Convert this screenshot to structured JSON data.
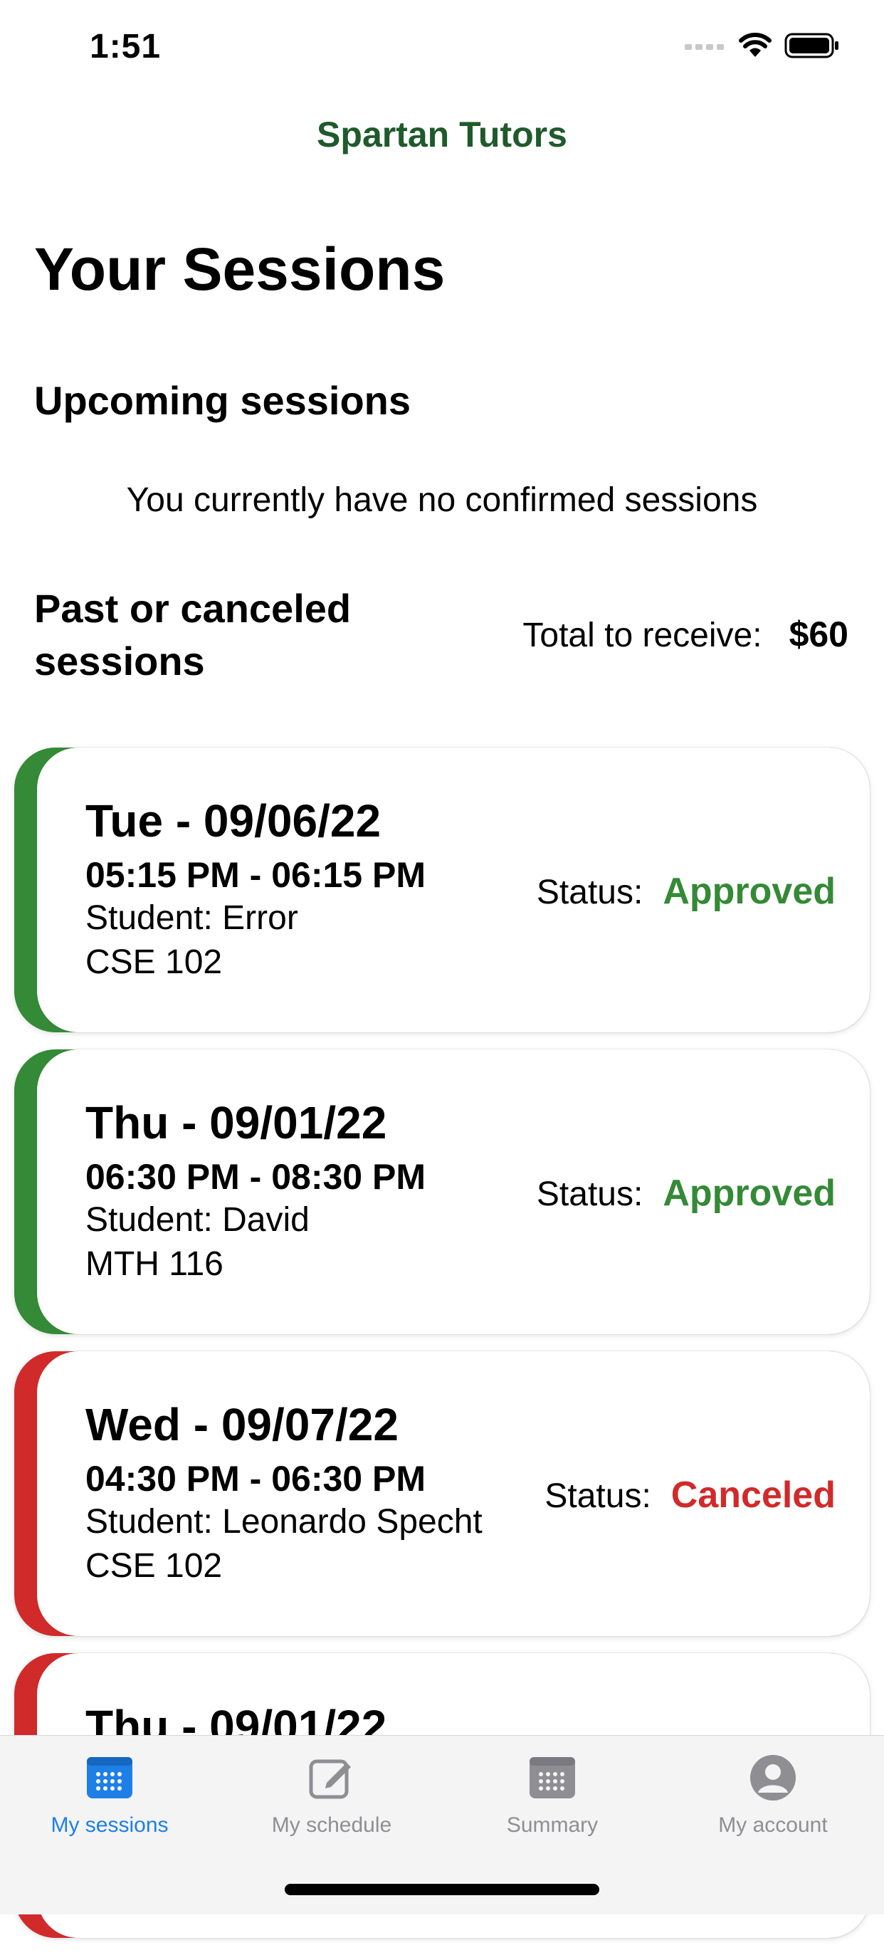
{
  "status_bar": {
    "time": "1:51"
  },
  "header": {
    "app_title": "Spartan Tutors"
  },
  "page": {
    "title": "Your Sessions",
    "upcoming_heading": "Upcoming sessions",
    "upcoming_empty": "You currently have no confirmed sessions",
    "past_heading": "Past or canceled sessions",
    "total_label": "Total to receive:",
    "total_value": "$60"
  },
  "colors": {
    "brand": "#1f5a2b",
    "approved": "#348a36",
    "canceled": "#d12a2a",
    "tab_active": "#1e7fe6",
    "tab_inactive": "#8e8e93"
  },
  "sessions": [
    {
      "date": "Tue - 09/06/22",
      "time": "05:15 PM - 06:15 PM",
      "student": "Student: Error",
      "course": "CSE 102",
      "status_label": "Status:",
      "status": "Approved"
    },
    {
      "date": "Thu - 09/01/22",
      "time": "06:30 PM - 08:30 PM",
      "student": "Student: David",
      "course": "MTH 116",
      "status_label": "Status:",
      "status": "Approved"
    },
    {
      "date": "Wed - 09/07/22",
      "time": "04:30 PM - 06:30 PM",
      "student": "Student: Leonardo Specht",
      "course": "CSE 102",
      "status_label": "Status:",
      "status": "Canceled"
    },
    {
      "date": "Thu - 09/01/22",
      "time": "",
      "student": "",
      "course": "",
      "status_label": "",
      "status": ""
    }
  ],
  "tabbar": {
    "items": [
      {
        "label": "My sessions",
        "icon": "calendar-icon",
        "active": true
      },
      {
        "label": "My schedule",
        "icon": "edit-square-icon",
        "active": false
      },
      {
        "label": "Summary",
        "icon": "calendar-icon",
        "active": false
      },
      {
        "label": "My account",
        "icon": "account-circle-icon",
        "active": false
      }
    ]
  }
}
